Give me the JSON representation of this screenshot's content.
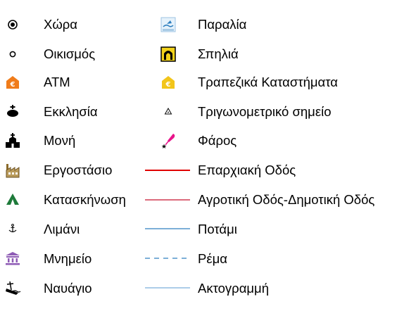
{
  "colors": {
    "atm_orange": "#f07c1a",
    "bank_yellow": "#f2c51a",
    "camping_green": "#1e7a3a",
    "monument_purple": "#8e5bb5",
    "lighthouse_pink": "#e8148a",
    "provincial_road": "#e00000",
    "rural_road": "#c8102e",
    "river": "#2f7fbf",
    "stream": "#2f7fbf",
    "coastline": "#5a9bd0"
  },
  "legend": {
    "left": [
      {
        "label": "Χώρα",
        "icon": "capital-dot-icon"
      },
      {
        "label": "Οικισμός",
        "icon": "settlement-circle-icon"
      },
      {
        "label": "ATM",
        "icon": "atm-icon"
      },
      {
        "label": "Εκκλησία",
        "icon": "church-icon"
      },
      {
        "label": "Μονή",
        "icon": "monastery-icon"
      },
      {
        "label": "Εργοστάσιο",
        "icon": "factory-icon"
      },
      {
        "label": "Κατασκήνωση",
        "icon": "camping-tent-icon"
      },
      {
        "label": "Λιμάνι",
        "icon": "anchor-icon"
      },
      {
        "label": "Μνημείο",
        "icon": "monument-icon"
      },
      {
        "label": "Ναυάγιο",
        "icon": "shipwreck-icon"
      }
    ],
    "right": [
      {
        "label": "Παραλία",
        "icon": "beach-icon"
      },
      {
        "label": "Σπηλιά",
        "icon": "cave-icon"
      },
      {
        "label": "Τραπεζικά Καταστήματα",
        "icon": "bank-icon"
      },
      {
        "label": "Τριγωνομετρικό σημείο",
        "icon": "trig-point-icon"
      },
      {
        "label": "Φάρος",
        "icon": "lighthouse-icon"
      },
      {
        "label": "Επαρχιακή Οδός",
        "icon": "provincial-road-line"
      },
      {
        "label": "Αγροτική Οδός-Δημοτική Οδός",
        "icon": "rural-road-line"
      },
      {
        "label": "Ποτάμι",
        "icon": "river-line"
      },
      {
        "label": "Ρέμα",
        "icon": "stream-dashed-line"
      },
      {
        "label": "Ακτογραμμή",
        "icon": "coastline-line"
      }
    ]
  }
}
